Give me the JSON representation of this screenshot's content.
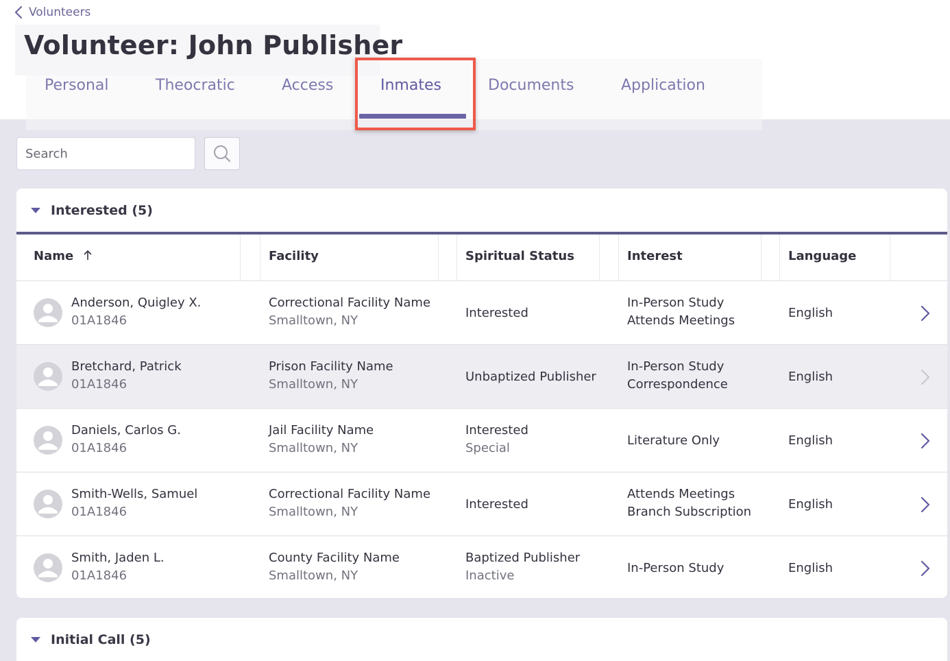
{
  "nav": {
    "back_label": "Volunteers"
  },
  "page": {
    "title": "Volunteer: John Publisher"
  },
  "tabs": [
    {
      "label": "Personal"
    },
    {
      "label": "Theocratic"
    },
    {
      "label": "Access"
    },
    {
      "label": "Inmates"
    },
    {
      "label": "Documents"
    },
    {
      "label": "Application"
    }
  ],
  "active_tab": "Inmates",
  "search": {
    "placeholder": "Search",
    "value": ""
  },
  "sections": [
    {
      "title": "Interested (5)",
      "columns": [
        "Name",
        "Facility",
        "Spiritual Status",
        "Interest",
        "Language"
      ],
      "rows": [
        {
          "name": "Anderson, Quigley X.",
          "id": "01A1846",
          "facility": "Correctional Facility Name",
          "location": "Smalltown, NY",
          "status": "Interested",
          "status_sub": "",
          "interest": "In-Person Study",
          "interest_sub": "Attends Meetings",
          "language": "English"
        },
        {
          "name": "Bretchard, Patrick",
          "id": "01A1846",
          "facility": "Prison Facility Name",
          "location": "Smalltown, NY",
          "status": "Unbaptized Publisher",
          "status_sub": "",
          "interest": "In-Person Study",
          "interest_sub": "Correspondence",
          "language": "English"
        },
        {
          "name": "Daniels, Carlos G.",
          "id": "01A1846",
          "facility": "Jail Facility Name",
          "location": "Smalltown, NY",
          "status": "Interested",
          "status_sub": "Special",
          "interest": "Literature Only",
          "interest_sub": "",
          "language": "English"
        },
        {
          "name": "Smith-Wells, Samuel",
          "id": "01A1846",
          "facility": "Correctional Facility Name",
          "location": "Smalltown, NY",
          "status": "Interested",
          "status_sub": "",
          "interest": "Attends Meetings",
          "interest_sub": "Branch Subscription",
          "language": "English"
        },
        {
          "name": "Smith, Jaden L.",
          "id": "01A1846",
          "facility": "County Facility Name",
          "location": "Smalltown, NY",
          "status": "Baptized Publisher",
          "status_sub": "Inactive",
          "interest": "In-Person Study",
          "interest_sub": "",
          "language": "English"
        }
      ]
    },
    {
      "title": "Initial Call (5)"
    }
  ],
  "icons": {
    "back": "chevron-left-icon",
    "search": "search-icon",
    "sort": "arrow-up-icon",
    "collapse": "caret-down-icon",
    "avatar": "user-avatar-icon",
    "row_action": "chevron-right-icon"
  },
  "colors": {
    "accent": "#6b65a6",
    "tab_text": "#7d79ad",
    "highlight": "#ee5a4a",
    "background": "#e6e5ee"
  }
}
